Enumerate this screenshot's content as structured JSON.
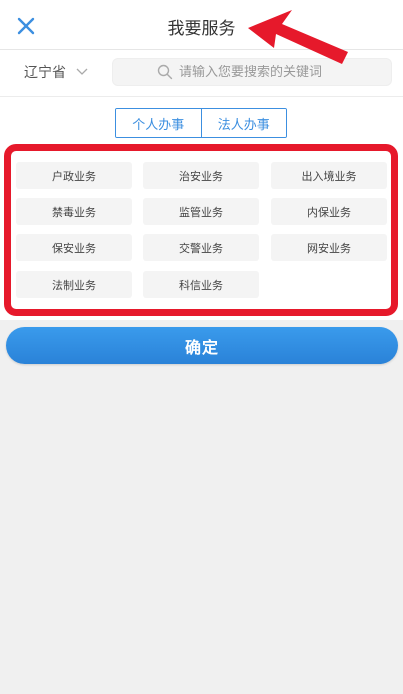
{
  "header": {
    "title": "我要服务",
    "close_icon": "close-x-icon"
  },
  "filter": {
    "region": "辽宁省",
    "search_placeholder": "请输入您要搜索的关键词"
  },
  "segments": [
    {
      "label": "个人办事"
    },
    {
      "label": "法人办事"
    }
  ],
  "categories": [
    {
      "label": "户政业务"
    },
    {
      "label": "治安业务"
    },
    {
      "label": "出入境业务"
    },
    {
      "label": "禁毒业务"
    },
    {
      "label": "监管业务"
    },
    {
      "label": "内保业务"
    },
    {
      "label": "保安业务"
    },
    {
      "label": "交警业务"
    },
    {
      "label": "网安业务"
    },
    {
      "label": "法制业务"
    },
    {
      "label": "科信业务"
    }
  ],
  "confirm_label": "确定",
  "colors": {
    "accent": "#3c8fe0",
    "annotation_red": "#e6192b",
    "button_blue": "#2a82d8"
  }
}
